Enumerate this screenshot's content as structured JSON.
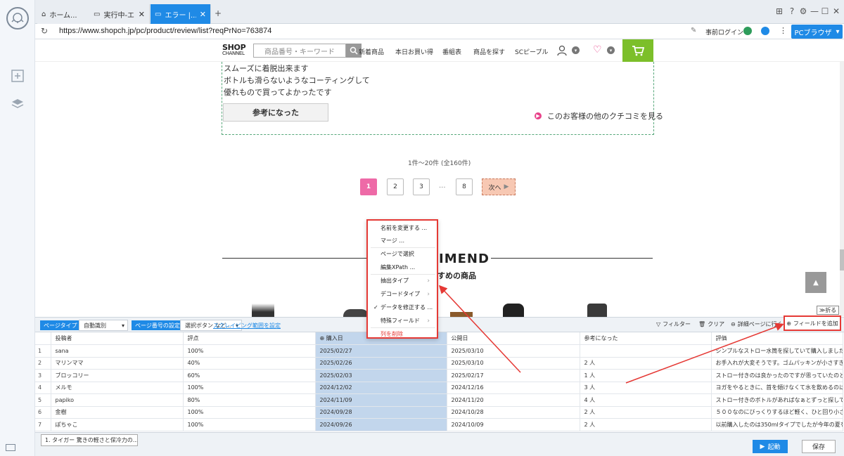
{
  "browser": {
    "tabs": [
      {
        "label": "ホーム...",
        "icon": "home-icon",
        "active": false
      },
      {
        "label": "実行中-エ...",
        "icon": "page-icon",
        "active": false
      },
      {
        "label": "エラー |...",
        "icon": "page-icon",
        "active": true
      }
    ],
    "url": "https://www.shopch.jp/pc/product/review/list?reqPrNo=763874",
    "login_label": "事前ログイン",
    "browser_mode_label": "PCブラウザ"
  },
  "site": {
    "logo_line1": "SHOP",
    "logo_line2": "CHANNEL",
    "search_placeholder": "商品番号・キーワード",
    "nav": [
      "新着商品",
      "本日お買い得",
      "番組表",
      "商品を探す",
      "SCピープル"
    ]
  },
  "review": {
    "lines": [
      "スムーズに着脱出来ます",
      "ボトルも滑らないようなコーティングして",
      "優れもので買ってよかったです"
    ],
    "helpful_button": "参考になった",
    "other_reviews_link": "このお客様の他のクチコミを見る"
  },
  "pagination": {
    "count_text": "1件～20件 (全160件)",
    "pages": [
      "1",
      "2",
      "3",
      "8"
    ],
    "ellipsis": "...",
    "next_label": "次へ"
  },
  "recommend": {
    "title": "IMEND",
    "subtitle": "すめの商品",
    "collapse_label": "折る"
  },
  "context_menu": {
    "items": [
      {
        "label": "名前を変更する ...",
        "submenu": false,
        "checked": false,
        "danger": false
      },
      {
        "label": "マージ ...",
        "submenu": false,
        "checked": false,
        "danger": false
      },
      {
        "label": "ページで選択",
        "submenu": false,
        "checked": false,
        "danger": false
      },
      {
        "label": "編集XPath ...",
        "submenu": false,
        "checked": false,
        "danger": false
      },
      {
        "label": "抽出タイプ",
        "submenu": true,
        "checked": false,
        "danger": false
      },
      {
        "label": "デコードタイプ",
        "submenu": true,
        "checked": false,
        "danger": false
      },
      {
        "label": "データを修正する ...",
        "submenu": false,
        "checked": true,
        "danger": false
      },
      {
        "label": "特殊フィールド",
        "submenu": true,
        "checked": false,
        "danger": false
      },
      {
        "label": "列を削除",
        "submenu": false,
        "checked": false,
        "danger": true
      }
    ]
  },
  "toolbar": {
    "page_type_label": "ページタイプ",
    "page_type_value": "自動識別",
    "page_number_label": "ページ番号の設定",
    "page_number_value": "選択ボタン など...",
    "scrape_range_link": "スクレイピング範囲を設定",
    "filter_label": "フィルター",
    "clear_label": "クリア",
    "detail_label": "詳細ページに行く",
    "add_field_label": "フィールドを追加"
  },
  "table": {
    "columns": [
      "",
      "投稿者",
      "評点",
      "購入日",
      "公開日",
      "参考になった",
      "評価"
    ],
    "rows": [
      [
        "1",
        "sana",
        "100%",
        "2025/02/27",
        "2025/03/10",
        "",
        "シンプルなストロー水筒を探していて購入しました..."
      ],
      [
        "2",
        "マリンママ",
        "40%",
        "2025/02/26",
        "2025/03/10",
        "2 人",
        "お手入れが大変そうです。ゴムパッキンが小さすぎ..."
      ],
      [
        "3",
        "ブロッコリー",
        "60%",
        "2025/02/03",
        "2025/02/17",
        "1 人",
        "ストロー付きのは良かったのですが思っていたのと..."
      ],
      [
        "4",
        "メルモ",
        "100%",
        "2024/12/02",
        "2024/12/16",
        "3 人",
        "ヨガをやるときに、首を傾けなくて水を飲めるのは..."
      ],
      [
        "5",
        "papiko",
        "80%",
        "2024/11/09",
        "2024/11/20",
        "4 人",
        "ストロー付きのボトルがあればなぁとずっと探して..."
      ],
      [
        "6",
        "金樹",
        "100%",
        "2024/09/28",
        "2024/10/28",
        "2 人",
        "５００なのにびっくりするほど軽く、ひと回り小さ..."
      ],
      [
        "7",
        "ぽちゃこ",
        "100%",
        "2024/09/26",
        "2024/10/09",
        "2 人",
        "以前購入したのは350mlタイプでしたが今年の夏を..."
      ]
    ]
  },
  "bottom": {
    "task_tab": "1. タイガー 驚きの軽さと保冷力の...",
    "run_label": "起動",
    "save_label": "保存"
  },
  "colors": {
    "accent": "#1f8ae6",
    "highlight_column": "#c2d6ec",
    "annotation_red": "#e53935",
    "page_active": "#ee6aa7",
    "cart_green": "#7cbf2a"
  }
}
